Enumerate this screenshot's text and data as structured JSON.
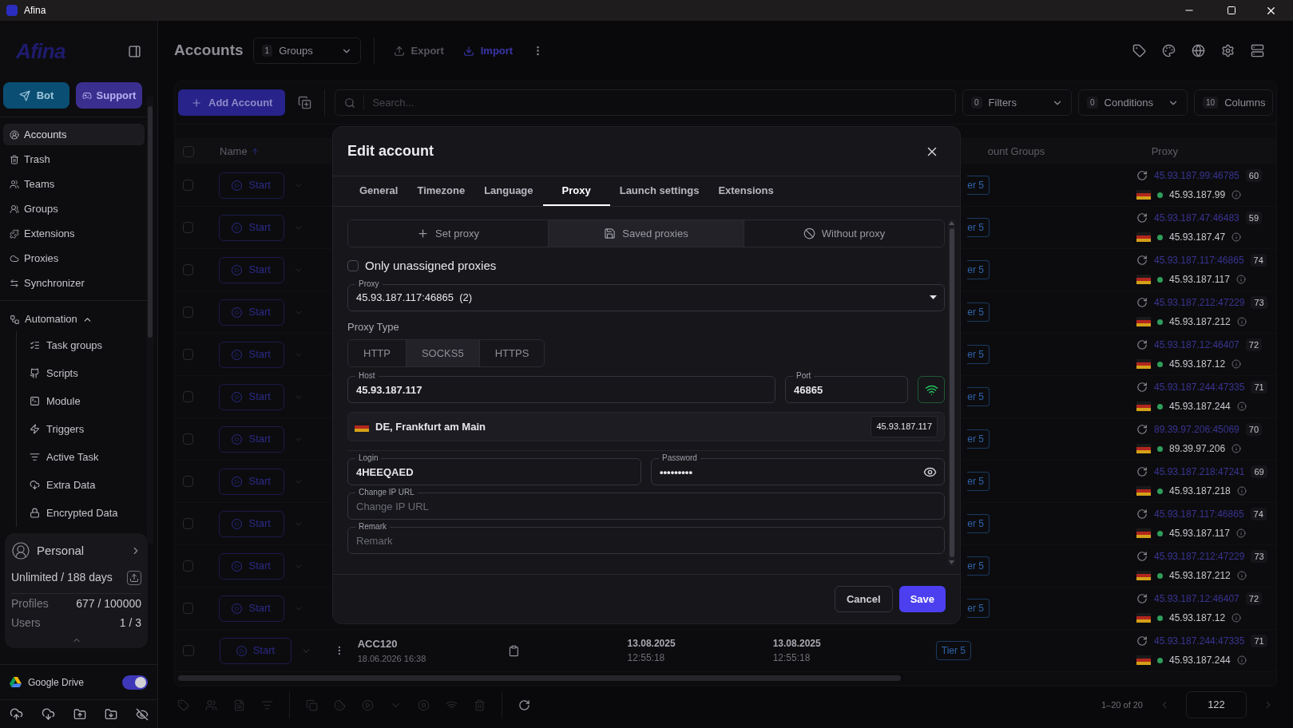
{
  "window": {
    "title": "Afina"
  },
  "sidebar": {
    "logo": "Afina",
    "bot_button": "Bot",
    "support_button": "Support",
    "items": [
      {
        "label": "Accounts",
        "selected": true,
        "kind": "accounts"
      },
      {
        "label": "Trash",
        "selected": false,
        "kind": "trash"
      },
      {
        "label": "Teams",
        "selected": false,
        "kind": "teams"
      },
      {
        "label": "Groups",
        "selected": false,
        "kind": "groups"
      },
      {
        "label": "Extensions",
        "selected": false,
        "kind": "extensions"
      },
      {
        "label": "Proxies",
        "selected": false,
        "kind": "proxies"
      },
      {
        "label": "Synchronizer",
        "selected": false,
        "kind": "sync"
      }
    ],
    "automation": {
      "label": "Automation",
      "expanded": true,
      "children": [
        {
          "label": "Task groups",
          "kind": "taskgroups"
        },
        {
          "label": "Scripts",
          "kind": "scripts"
        },
        {
          "label": "Module",
          "kind": "module"
        },
        {
          "label": "Triggers",
          "kind": "triggers"
        },
        {
          "label": "Active Task",
          "kind": "activetask"
        },
        {
          "label": "Extra Data",
          "kind": "extradata"
        },
        {
          "label": "Encrypted Data",
          "kind": "encrypted"
        }
      ]
    },
    "plan": {
      "name": "Personal",
      "term": "Unlimited / 188 days",
      "stats": [
        {
          "label": "Profiles",
          "value": "677 / 100000"
        },
        {
          "label": "Users",
          "value": "1 / 3"
        }
      ]
    },
    "google_drive": {
      "label": "Google Drive",
      "on": true
    }
  },
  "header": {
    "title": "Accounts",
    "groups_count": "1",
    "groups_label": "Groups",
    "actions": [
      {
        "label": "Export",
        "disabled": true,
        "kind": "export"
      },
      {
        "label": "Import",
        "disabled": false,
        "kind": "import"
      }
    ]
  },
  "toolbar": {
    "add_button": "Add Account",
    "search_placeholder": "Search...",
    "filters": [
      {
        "count": "0",
        "label": "Filters",
        "dropdown": true
      },
      {
        "count": "0",
        "label": "Conditions",
        "dropdown": true
      },
      {
        "count": "10",
        "label": "Columns",
        "dropdown": false
      }
    ]
  },
  "table": {
    "all_checked": false,
    "columns": [
      {
        "label": "Name",
        "sorted": true
      },
      {
        "label": "ount Groups",
        "sorted": false
      },
      {
        "label": "Proxy",
        "sorted": false
      }
    ],
    "rows": [
      {
        "checked": false,
        "start": "Start",
        "tier": "er 5",
        "proxy": "45.93.187.99:46785",
        "score": "60",
        "ip": "45.93.187.99"
      },
      {
        "checked": false,
        "start": "Start",
        "tier": "er 5",
        "proxy": "45.93.187.47:46483",
        "score": "59",
        "ip": "45.93.187.47"
      },
      {
        "checked": false,
        "start": "Start",
        "tier": "er 5",
        "proxy": "45.93.187.117:46865",
        "score": "74",
        "ip": "45.93.187.117"
      },
      {
        "checked": false,
        "start": "Start",
        "tier": "er 5",
        "proxy": "45.93.187.212:47229",
        "score": "73",
        "ip": "45.93.187.212"
      },
      {
        "checked": false,
        "start": "Start",
        "tier": "er 5",
        "proxy": "45.93.187.12:46407",
        "score": "72",
        "ip": "45.93.187.12"
      },
      {
        "checked": false,
        "start": "Start",
        "tier": "er 5",
        "proxy": "45.93.187.244:47335",
        "score": "71",
        "ip": "45.93.187.244"
      },
      {
        "checked": false,
        "start": "Start",
        "tier": "er 5",
        "proxy": "89.39.97.206:45069",
        "score": "70",
        "ip": "89.39.97.206"
      },
      {
        "checked": false,
        "start": "Start",
        "tier": "er 5",
        "proxy": "45.93.187.218:47241",
        "score": "69",
        "ip": "45.93.187.218"
      },
      {
        "checked": false,
        "start": "Start",
        "tier": "er 5",
        "proxy": "45.93.187.117:46865",
        "score": "74",
        "ip": "45.93.187.117"
      },
      {
        "checked": false,
        "start": "Start",
        "tier": "er 5",
        "proxy": "45.93.187.212:47229",
        "score": "73",
        "ip": "45.93.187.212"
      },
      {
        "checked": false,
        "start": "Start",
        "tier": "er 5",
        "proxy": "45.93.187.12:46407",
        "score": "72",
        "ip": "45.93.187.12"
      },
      {
        "checked": false,
        "start": "Start",
        "name": "ACC120",
        "name_date": "18.06.2026 16:38",
        "created": [
          "13.08.2025",
          "12:55:18"
        ],
        "updated": [
          "13.08.2025",
          "12:55:18"
        ],
        "tier": "Tier 5",
        "proxy": "45.93.187.244:47335",
        "score": "71",
        "ip": "45.93.187.244"
      }
    ]
  },
  "bottom_bar": {
    "tools": [
      {
        "kind": "tag",
        "disabled": true
      },
      {
        "kind": "users",
        "disabled": true
      },
      {
        "kind": "file",
        "disabled": true
      },
      {
        "kind": "list",
        "disabled": true
      },
      {
        "kind": "copy",
        "disabled": true
      },
      {
        "kind": "cookie",
        "disabled": true
      },
      {
        "kind": "play",
        "disabled": true
      },
      {
        "kind": "chevron",
        "disabled": true
      },
      {
        "kind": "stop",
        "disabled": true
      },
      {
        "kind": "wifi",
        "disabled": true
      },
      {
        "kind": "trash",
        "disabled": true
      },
      {
        "kind": "refresh",
        "disabled": false
      }
    ],
    "range": "1–20 of 20",
    "page": "122"
  },
  "dialog": {
    "title": "Edit account",
    "tabs": [
      {
        "label": "General",
        "selected": false
      },
      {
        "label": "Timezone",
        "selected": false
      },
      {
        "label": "Language",
        "selected": false
      },
      {
        "label": "Proxy",
        "selected": true
      },
      {
        "label": "Launch settings",
        "selected": false
      },
      {
        "label": "Extensions",
        "selected": false
      }
    ],
    "modes": [
      {
        "label": "Set proxy",
        "selected": false,
        "kind": "plus"
      },
      {
        "label": "Saved proxies",
        "selected": true,
        "kind": "saved"
      },
      {
        "label": "Without proxy",
        "selected": false,
        "kind": "none"
      }
    ],
    "only_unassigned": {
      "label": "Only unassigned proxies",
      "checked": false
    },
    "proxy_select": {
      "label": "Proxy",
      "value": "45.93.187.117:46865  (2)"
    },
    "proxy_type": {
      "label": "Proxy Type",
      "options": [
        {
          "label": "HTTP",
          "selected": false
        },
        {
          "label": "SOCKS5",
          "selected": true
        },
        {
          "label": "HTTPS",
          "selected": false
        }
      ]
    },
    "host": {
      "label": "Host",
      "value": "45.93.187.117"
    },
    "port": {
      "label": "Port",
      "value": "46865"
    },
    "location": {
      "text": "DE, Frankfurt am Main",
      "ip": "45.93.187.117"
    },
    "login": {
      "label": "Login",
      "value": "4HEEQAED"
    },
    "password": {
      "label": "Password",
      "value": "•••••••••"
    },
    "change_ip_url": {
      "label": "Change IP URL",
      "placeholder": "Change IP URL"
    },
    "remark": {
      "label": "Remark",
      "placeholder": "Remark"
    },
    "buttons": [
      {
        "label": "Cancel",
        "kind": "secondary"
      },
      {
        "label": "Save",
        "kind": "primary"
      }
    ]
  }
}
